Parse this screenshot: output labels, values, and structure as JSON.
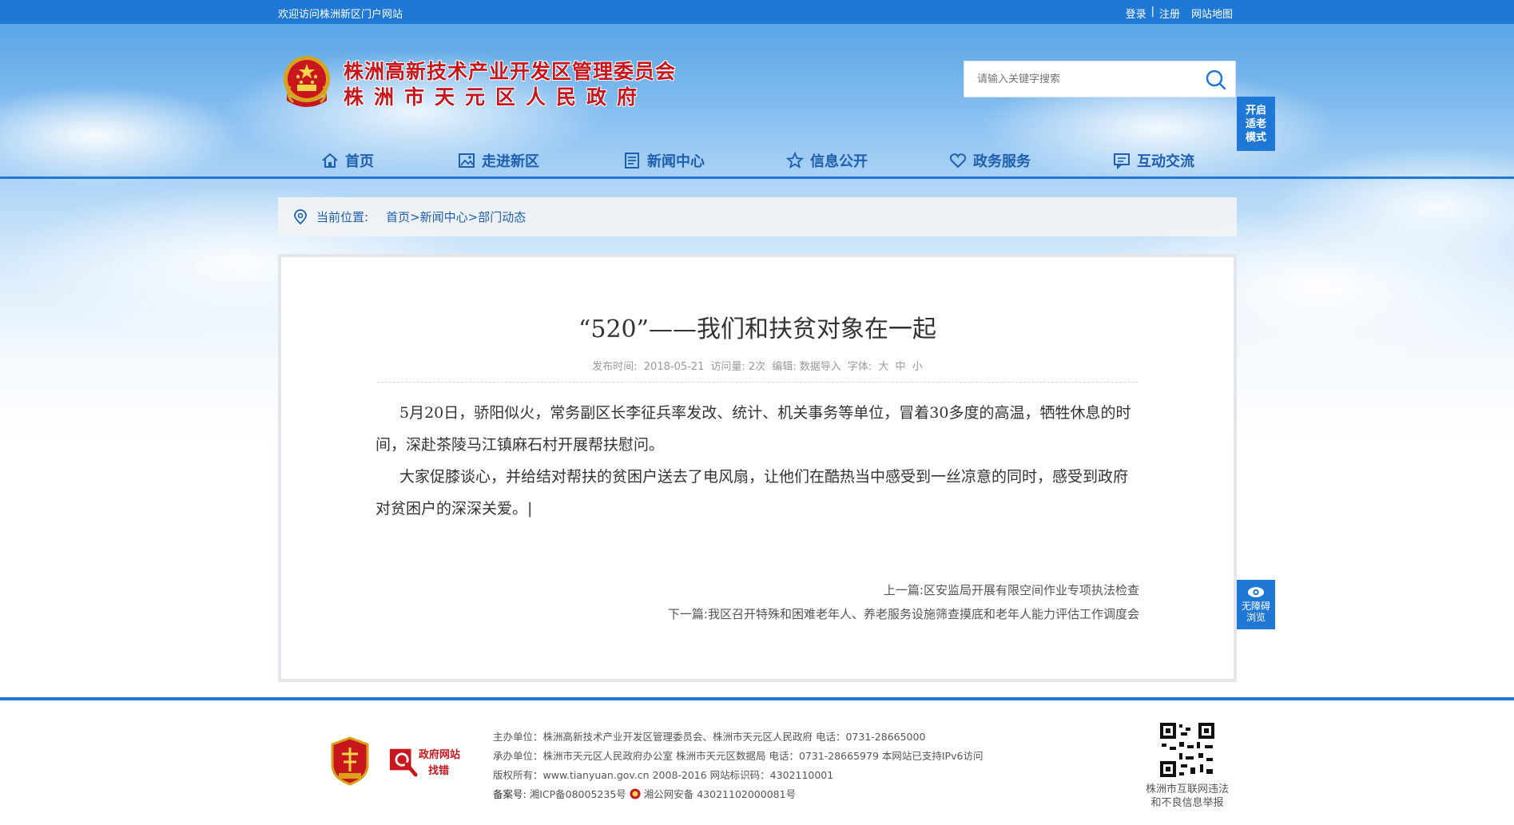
{
  "topbar": {
    "welcome": "欢迎访问株洲新区门户网站",
    "login": "登录",
    "sep": "|",
    "register": "注册",
    "sitemap": "网站地图"
  },
  "header": {
    "title_line1": "株洲高新技术产业开发区管理委员会",
    "title_line2": "株洲市天元区人民政府",
    "search_placeholder": "请输入关键字搜索",
    "elder_mode_label": "开启适老模式"
  },
  "nav": {
    "items": [
      {
        "label": "首页",
        "icon": "home-icon"
      },
      {
        "label": "走进新区",
        "icon": "picture-icon"
      },
      {
        "label": "新闻中心",
        "icon": "newspaper-icon"
      },
      {
        "label": "信息公开",
        "icon": "star-icon"
      },
      {
        "label": "政务服务",
        "icon": "heart-icon"
      },
      {
        "label": "互动交流",
        "icon": "chat-icon"
      }
    ]
  },
  "breadcrumb": {
    "label": "当前位置:",
    "home": "首页",
    "level1": "新闻中心",
    "level2": "部门动态",
    "arrow": ">"
  },
  "article": {
    "title": "“520”——我们和扶贫对象在一起",
    "meta": {
      "publish_label": "发布时间:",
      "publish_date": "2018-05-21",
      "views_label": "访问量:",
      "views": "2次",
      "editor_label": "编辑:",
      "editor": "数据导入",
      "font_label": "字体:",
      "font_large": "大",
      "font_medium": "中",
      "font_small": "小"
    },
    "paragraphs": [
      "5月20日，骄阳似火，常务副区长李征兵率发改、统计、机关事务等单位，冒着30多度的高温，牺牲休息的时间，深赴茶陵马江镇麻石村开展帮扶慰问。",
      "大家促膝谈心，并给结对帮扶的贫困户送去了电风扇，让他们在酷热当中感受到一丝凉意的同时，感受到政府对贫困户的深深关爱。|"
    ],
    "prev_label": "上一篇:",
    "prev_title": "区安监局开展有限空间作业专项执法检查",
    "next_label": "下一篇:",
    "next_title": "我区召开特殊和困难老年人、养老服务设施筛查摸底和老年人能力评估工作调度会"
  },
  "accessibility": {
    "label_line1": "无障碍",
    "label_line2": "浏览"
  },
  "footer": {
    "zhaocuo_line1": "政府网站",
    "zhaocuo_line2": "找错",
    "lines": [
      "主办单位：株洲高新技术产业开发区管理委员会、株洲市天元区人民政府 电话：0731-28665000",
      "承办单位：株洲市天元区人民政府办公室 株洲市天元区数据局 电话：0731-28665979 本网站已支持IPv6访问",
      "版权所有：www.tianyuan.gov.cn 2008-2016 网站标识码：4302110001"
    ],
    "icp_label": "备案号:",
    "icp": "湘ICP备08005235号",
    "police": "湘公网安备 43021102000081号",
    "qr_caption_line1": "株洲市互联网违法",
    "qr_caption_line2": "和不良信息举报"
  },
  "colors": {
    "brand_blue": "#1f78d6",
    "title_red": "#c8161d",
    "nav_text": "#1f5fae"
  }
}
